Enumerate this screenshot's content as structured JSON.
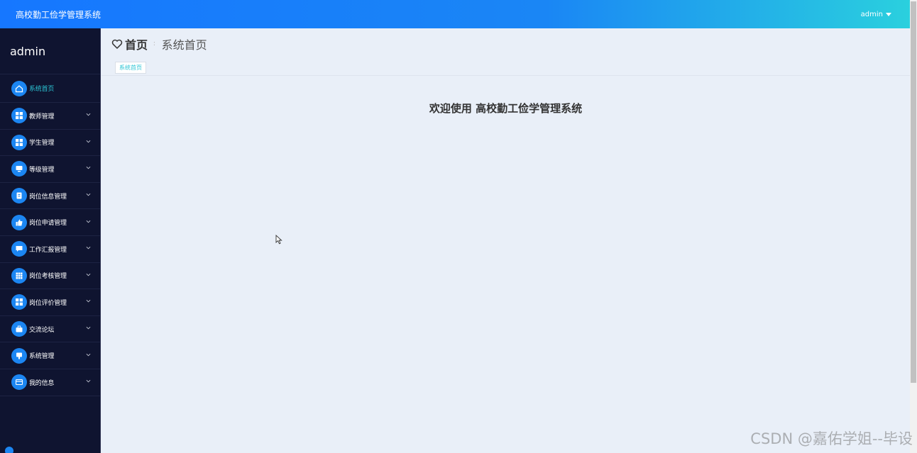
{
  "header": {
    "app_title": "高校勤工俭学管理系统",
    "user_label": "admin"
  },
  "sidebar": {
    "brand": "admin",
    "items": [
      {
        "label": "系统首页",
        "icon": "home-icon"
      },
      {
        "label": "教师管理",
        "icon": "grid-icon"
      },
      {
        "label": "学生管理",
        "icon": "grid-icon"
      },
      {
        "label": "等级管理",
        "icon": "monitor-icon"
      },
      {
        "label": "岗位信息管理",
        "icon": "clipboard-icon"
      },
      {
        "label": "岗位申请管理",
        "icon": "thumbs-up-icon"
      },
      {
        "label": "工作汇报管理",
        "icon": "message-icon"
      },
      {
        "label": "岗位考核管理",
        "icon": "table-icon"
      },
      {
        "label": "岗位评价管理",
        "icon": "grid-icon"
      },
      {
        "label": "交流论坛",
        "icon": "briefcase-icon"
      },
      {
        "label": "系统管理",
        "icon": "chat-icon"
      },
      {
        "label": "我的信息",
        "icon": "card-icon"
      }
    ]
  },
  "breadcrumb": {
    "home": "首页",
    "current": "系统首页"
  },
  "tabs": [
    {
      "label": "系统首页"
    }
  ],
  "main": {
    "welcome": "欢迎使用 高校勤工俭学管理系统"
  },
  "watermark": "CSDN @嘉佑学姐--毕设",
  "colors": {
    "accent": "#1677ff",
    "sidebar_bg": "#0f1430",
    "active_text": "#2bc4d4"
  }
}
